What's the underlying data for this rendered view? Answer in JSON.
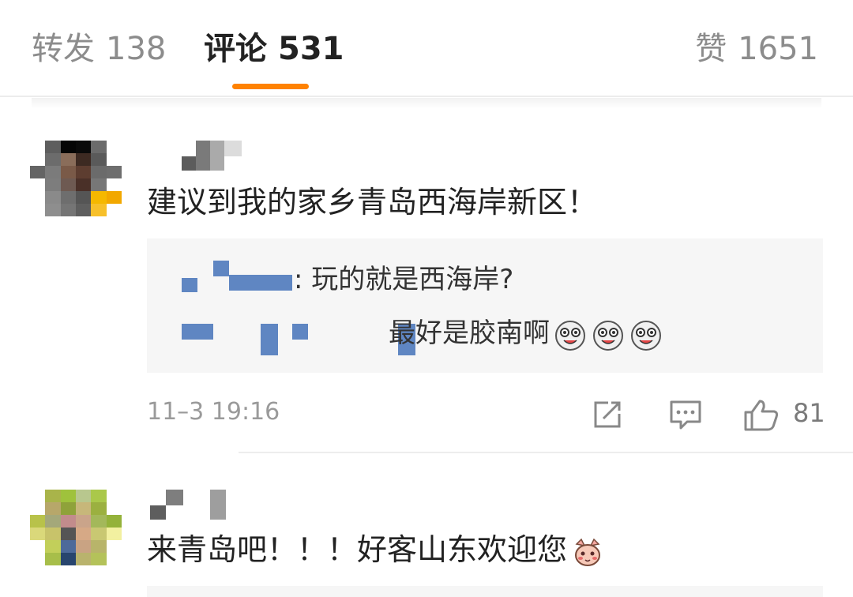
{
  "tabs": {
    "repost": {
      "label": "转发",
      "count": "138"
    },
    "comment": {
      "label": "评论",
      "count": "531"
    },
    "like": {
      "label": "赞",
      "count": "1651"
    }
  },
  "comments": [
    {
      "text": "建议到我的家乡青岛西海岸新区！",
      "replies": [
        {
          "text": ": 玩的就是西海岸?"
        },
        {
          "text": "最好是胶南啊",
          "emojis": [
            "laughing-dog-emoji",
            "laughing-dog-emoji",
            "laughing-dog-emoji"
          ]
        }
      ],
      "timestamp": "11–3 19:16",
      "likes": "81"
    },
    {
      "text": "来青岛吧！！！好客山东欢迎您",
      "emojis": [
        "shy-cat-emoji"
      ]
    }
  ],
  "colors": {
    "accent": "#ff8200",
    "reply_name": "#5f86c2",
    "muted": "#9a9a9a"
  }
}
